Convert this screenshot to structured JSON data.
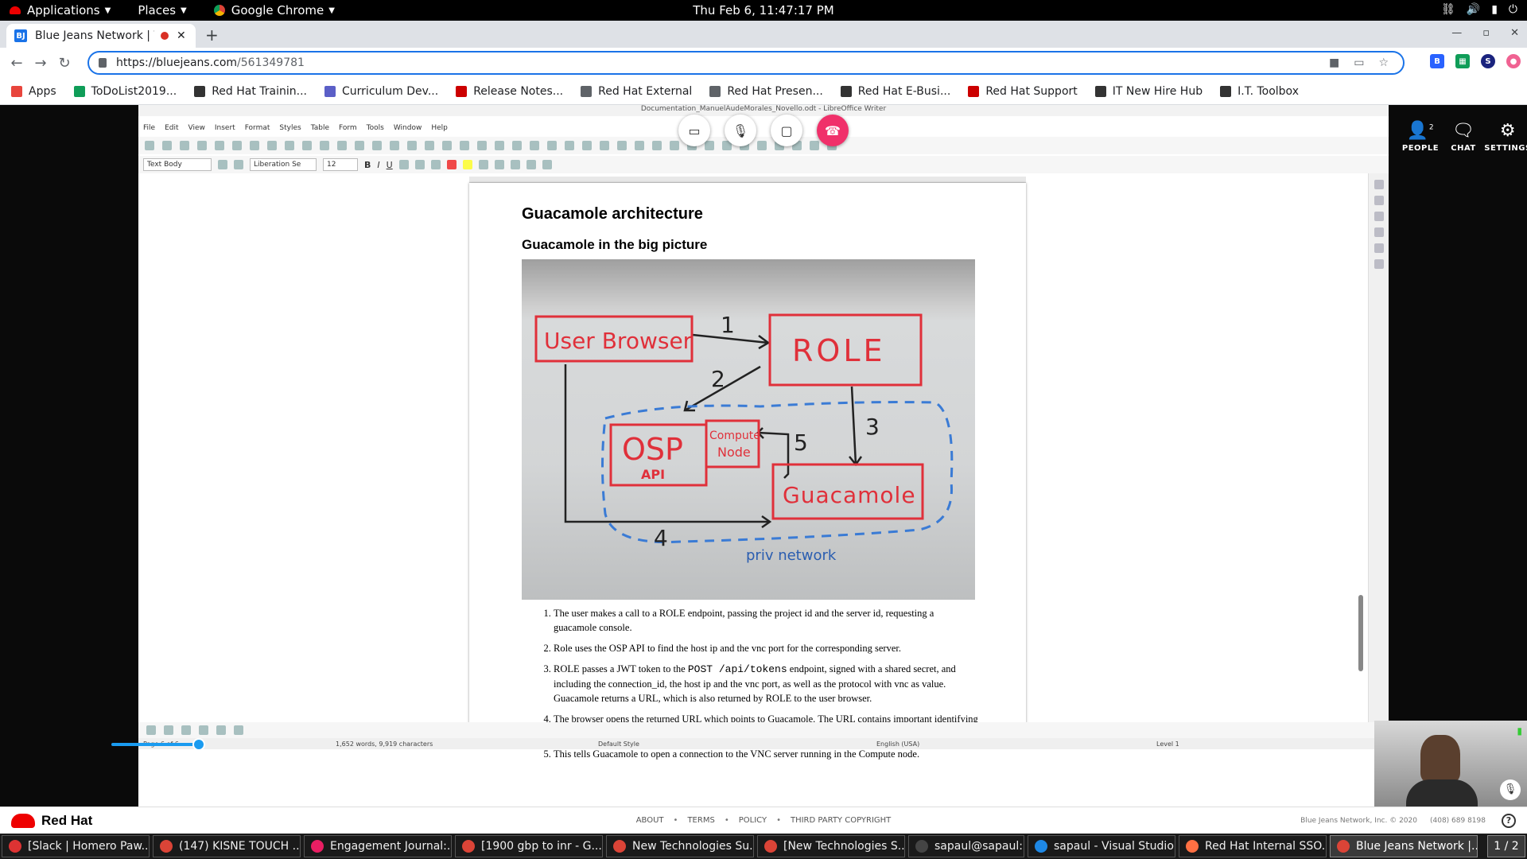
{
  "topbar": {
    "applications": "Applications",
    "places": "Places",
    "browser": "Google Chrome",
    "clock": "Thu Feb  6, 11:47:17 PM"
  },
  "browser": {
    "tab_title": "Blue Jeans Network | \\",
    "url_host": "https://bluejeans.com",
    "url_path": "/561349781",
    "new_tab": "+",
    "profile_initial": "S"
  },
  "bookmarks": [
    {
      "label": "Apps",
      "color": "#e8453c"
    },
    {
      "label": "ToDoList2019...",
      "color": "#0f9d58"
    },
    {
      "label": "Red Hat Trainin...",
      "color": "#333333"
    },
    {
      "label": "Curriculum Dev...",
      "color": "#5b5fc7"
    },
    {
      "label": "Release Notes...",
      "color": "#cc0000"
    },
    {
      "label": "Red Hat External",
      "color": "#5f6368"
    },
    {
      "label": "Red Hat Presen...",
      "color": "#5f6368"
    },
    {
      "label": "Red Hat E-Busi...",
      "color": "#333333"
    },
    {
      "label": "Red Hat Support",
      "color": "#cc0000"
    },
    {
      "label": "IT New Hire Hub",
      "color": "#333333"
    },
    {
      "label": "I.T. Toolbox",
      "color": "#333333"
    }
  ],
  "libreoffice": {
    "window_title": "Documentation_ManuelAudeMorales_Novello.odt - LibreOffice Writer",
    "menu": [
      "File",
      "Edit",
      "View",
      "Insert",
      "Format",
      "Styles",
      "Table",
      "Form",
      "Tools",
      "Window",
      "Help"
    ],
    "paragraph_style": "Text Body",
    "font_name": "Liberation Se",
    "font_size": "12",
    "bold": "B",
    "italic": "I",
    "underline": "U",
    "status": {
      "page": "Page 6 of 6",
      "words": "1,652 words, 9,919 characters",
      "style": "Default Style",
      "language": "English (USA)",
      "level": "Level 1"
    }
  },
  "document": {
    "heading1": "Guacamole architecture",
    "heading2": "Guacamole in the big picture",
    "whiteboard": {
      "user_browser": "User Browser",
      "role": "ROLE",
      "osp": "OSP",
      "api": "API",
      "compute": "Compute",
      "node": "Node",
      "guacamole": "Guacamole",
      "priv_network": "priv network",
      "n1": "1",
      "n2": "2",
      "n3": "3",
      "n4": "4",
      "n5": "5"
    },
    "steps": [
      {
        "pre": "The user makes a call to a ROLE endpoint, passing the project id and the server id, requesting a guacamole console."
      },
      {
        "pre": "Role uses the OSP API to find the host ip and the vnc port for the corresponding server."
      },
      {
        "pre": "ROLE passes a JWT token to the ",
        "code": "POST /api/tokens",
        "post": " endpoint, signed with a shared secret, and including the connection_id, the host ip and the vnc port, as well as the protocol with vnc as value. Guacamole returns a URL, which is also returned by ROLE to the user browser."
      },
      {
        "pre": "The browser opens the returned URL which points to Guacamole. The URL contains important identifying information, including a token and a route parameter."
      },
      {
        "pre": "This tells Guacamole to open a connection to the VNC server running in the Compute node."
      }
    ]
  },
  "bluejeans": {
    "people": "PEOPLE",
    "people_count": "2",
    "chat": "CHAT",
    "settings": "SETTINGS",
    "accent": "#f0306a"
  },
  "footer": {
    "brand": "Red Hat",
    "links": [
      "ABOUT",
      "TERMS",
      "POLICY",
      "THIRD PARTY COPYRIGHT"
    ],
    "copyright": "Blue Jeans Network, Inc. © 2020",
    "phone": "(408) 689 8198",
    "help": "?"
  },
  "taskbar": {
    "items": [
      {
        "label": "[Slack | Homero Paw...",
        "color": "#d33"
      },
      {
        "label": "(147) KISNE TOUCH ...",
        "color": "#db4437"
      },
      {
        "label": "Engagement Journal:...",
        "color": "#e91e63"
      },
      {
        "label": "[1900 gbp to inr - G...",
        "color": "#db4437"
      },
      {
        "label": "New Technologies Su...",
        "color": "#db4437"
      },
      {
        "label": "[New Technologies S...",
        "color": "#db4437"
      },
      {
        "label": "sapaul@sapaul:~",
        "color": "#444444"
      },
      {
        "label": "sapaul - Visual Studio...",
        "color": "#1e88e5"
      },
      {
        "label": "Red Hat Internal SSO...",
        "color": "#ff7043"
      },
      {
        "label": "Blue Jeans Network |...",
        "color": "#db4437"
      }
    ],
    "pager": "1 / 2"
  }
}
